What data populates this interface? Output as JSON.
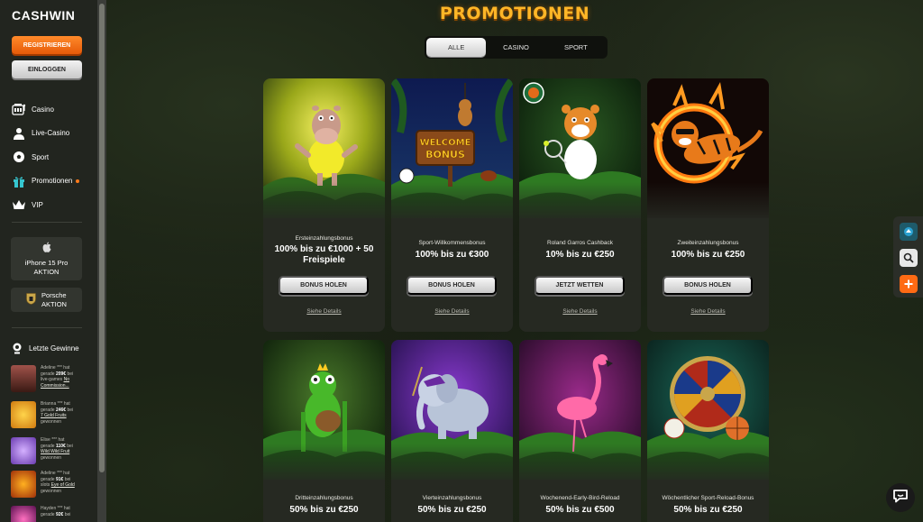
{
  "brand": {
    "logo": "CASHWIN"
  },
  "auth": {
    "register_label": "REGISTRIEREN",
    "login_label": "EINLOGGEN"
  },
  "nav": {
    "items": [
      {
        "label": "Casino",
        "icon": "slot-machine-icon"
      },
      {
        "label": "Live-Casino",
        "icon": "dealer-icon"
      },
      {
        "label": "Sport",
        "icon": "soccer-ball-icon"
      },
      {
        "label": "Promotionen",
        "icon": "gift-icon",
        "badge": true
      },
      {
        "label": "VIP",
        "icon": "crown-icon"
      }
    ]
  },
  "side_promos": [
    {
      "line1": "iPhone 15 Pro",
      "line2": "AKTION",
      "icon": "apple-icon"
    },
    {
      "line1": "Porsche",
      "line2": "AKTION",
      "icon": "porsche-crest-icon"
    }
  ],
  "winners": {
    "title": "Letzte Gewinne",
    "items": [
      {
        "name": "Adeline *** hat",
        "line2": "gerade",
        "amount": "209€",
        "line2b": "bei",
        "line3": "live-games",
        "game": "No Commission...",
        "color": "#7a3b2a"
      },
      {
        "name": "Brianna *** hat",
        "line2": "gerade",
        "amount": "246€",
        "line2b": "bei",
        "game": "7 Gold Fruits",
        "line3": "gewonnen",
        "color": "#e0a020"
      },
      {
        "name": "Elise *** hat",
        "line2": "gerade",
        "amount": "110€",
        "line2b": "bei",
        "game": "Wild Wild Fruit",
        "line3": "gewonnen",
        "color": "#9a6ad0"
      },
      {
        "name": "Adeline *** hat",
        "line2": "gerade",
        "amount": "91€",
        "line2b": "bei",
        "line3pre": "slots",
        "game": "Eye of Gold",
        "line3": "gewonnen",
        "color": "#d25a10"
      },
      {
        "name": "Hayden *** hat",
        "line2": "gerade",
        "amount": "92€",
        "line2b": "bei",
        "game": "",
        "line3": "",
        "color": "#b04090"
      }
    ]
  },
  "page": {
    "title": "PROMOTIONEN"
  },
  "tabs": [
    {
      "label": "ALLE",
      "active": true
    },
    {
      "label": "CASINO",
      "active": false
    },
    {
      "label": "SPORT",
      "active": false
    }
  ],
  "promotions": [
    {
      "category": "Ersteinzahlungsbonus",
      "headline": "100% bis zu €1000 + 50 Freispiele",
      "cta": "BONUS HOLEN",
      "details": "Siehe Details",
      "art": "hippo"
    },
    {
      "category": "Sport-Willkommensbonus",
      "headline": "100% bis zu €300",
      "cta": "BONUS HOLEN",
      "details": "Siehe Details",
      "art": "welcome"
    },
    {
      "category": "Roland Garros Cashback",
      "headline": "10% bis zu €250",
      "cta": "JETZT WETTEN",
      "details": "Siehe Details",
      "art": "tennis"
    },
    {
      "category": "Zweiteinzahlungsbonus",
      "headline": "100% bis zu €250",
      "cta": "BONUS HOLEN",
      "details": "Siehe Details",
      "art": "tiger"
    },
    {
      "category": "Dritteinzahlungsbonus",
      "headline": "50% bis zu €250",
      "art": "frog"
    },
    {
      "category": "Vierteinzahlungsbonus",
      "headline": "50% bis zu €250",
      "art": "elephant"
    },
    {
      "category": "Wochenend-Early-Bird-Reload",
      "headline": "50% bis zu €500",
      "art": "flamingo"
    },
    {
      "category": "Wöchentlicher Sport-Reload-Bonus",
      "headline": "50% bis zu €250",
      "art": "wheel"
    }
  ],
  "welcome_sign": {
    "line1": "WELCOME",
    "line2": "BONUS"
  },
  "tools": [
    {
      "icon": "app-icon"
    },
    {
      "icon": "search-icon"
    },
    {
      "icon": "plus-icon"
    }
  ],
  "chat": {
    "icon": "chat-icon"
  },
  "colors": {
    "accent": "#ff7a1a",
    "title_gold": "#ffb627",
    "sidebar_bg": "#22251f",
    "card_bg": "#262922"
  }
}
